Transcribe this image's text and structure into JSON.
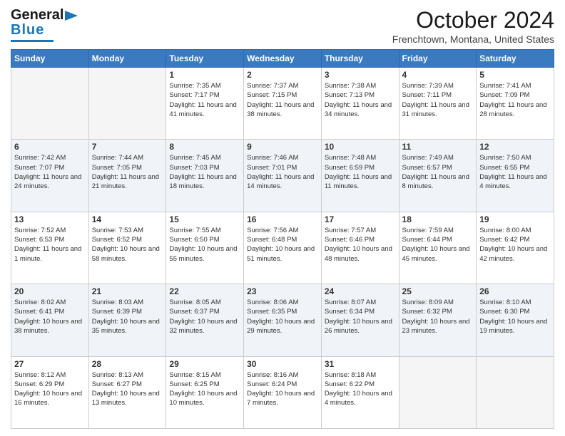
{
  "logo": {
    "general": "General",
    "blue": "Blue"
  },
  "title": "October 2024",
  "location": "Frenchtown, Montana, United States",
  "days_of_week": [
    "Sunday",
    "Monday",
    "Tuesday",
    "Wednesday",
    "Thursday",
    "Friday",
    "Saturday"
  ],
  "weeks": [
    [
      {
        "day": "",
        "info": ""
      },
      {
        "day": "",
        "info": ""
      },
      {
        "day": "1",
        "info": "Sunrise: 7:35 AM\nSunset: 7:17 PM\nDaylight: 11 hours and 41 minutes."
      },
      {
        "day": "2",
        "info": "Sunrise: 7:37 AM\nSunset: 7:15 PM\nDaylight: 11 hours and 38 minutes."
      },
      {
        "day": "3",
        "info": "Sunrise: 7:38 AM\nSunset: 7:13 PM\nDaylight: 11 hours and 34 minutes."
      },
      {
        "day": "4",
        "info": "Sunrise: 7:39 AM\nSunset: 7:11 PM\nDaylight: 11 hours and 31 minutes."
      },
      {
        "day": "5",
        "info": "Sunrise: 7:41 AM\nSunset: 7:09 PM\nDaylight: 11 hours and 28 minutes."
      }
    ],
    [
      {
        "day": "6",
        "info": "Sunrise: 7:42 AM\nSunset: 7:07 PM\nDaylight: 11 hours and 24 minutes."
      },
      {
        "day": "7",
        "info": "Sunrise: 7:44 AM\nSunset: 7:05 PM\nDaylight: 11 hours and 21 minutes."
      },
      {
        "day": "8",
        "info": "Sunrise: 7:45 AM\nSunset: 7:03 PM\nDaylight: 11 hours and 18 minutes."
      },
      {
        "day": "9",
        "info": "Sunrise: 7:46 AM\nSunset: 7:01 PM\nDaylight: 11 hours and 14 minutes."
      },
      {
        "day": "10",
        "info": "Sunrise: 7:48 AM\nSunset: 6:59 PM\nDaylight: 11 hours and 11 minutes."
      },
      {
        "day": "11",
        "info": "Sunrise: 7:49 AM\nSunset: 6:57 PM\nDaylight: 11 hours and 8 minutes."
      },
      {
        "day": "12",
        "info": "Sunrise: 7:50 AM\nSunset: 6:55 PM\nDaylight: 11 hours and 4 minutes."
      }
    ],
    [
      {
        "day": "13",
        "info": "Sunrise: 7:52 AM\nSunset: 6:53 PM\nDaylight: 11 hours and 1 minute."
      },
      {
        "day": "14",
        "info": "Sunrise: 7:53 AM\nSunset: 6:52 PM\nDaylight: 10 hours and 58 minutes."
      },
      {
        "day": "15",
        "info": "Sunrise: 7:55 AM\nSunset: 6:50 PM\nDaylight: 10 hours and 55 minutes."
      },
      {
        "day": "16",
        "info": "Sunrise: 7:56 AM\nSunset: 6:48 PM\nDaylight: 10 hours and 51 minutes."
      },
      {
        "day": "17",
        "info": "Sunrise: 7:57 AM\nSunset: 6:46 PM\nDaylight: 10 hours and 48 minutes."
      },
      {
        "day": "18",
        "info": "Sunrise: 7:59 AM\nSunset: 6:44 PM\nDaylight: 10 hours and 45 minutes."
      },
      {
        "day": "19",
        "info": "Sunrise: 8:00 AM\nSunset: 6:42 PM\nDaylight: 10 hours and 42 minutes."
      }
    ],
    [
      {
        "day": "20",
        "info": "Sunrise: 8:02 AM\nSunset: 6:41 PM\nDaylight: 10 hours and 38 minutes."
      },
      {
        "day": "21",
        "info": "Sunrise: 8:03 AM\nSunset: 6:39 PM\nDaylight: 10 hours and 35 minutes."
      },
      {
        "day": "22",
        "info": "Sunrise: 8:05 AM\nSunset: 6:37 PM\nDaylight: 10 hours and 32 minutes."
      },
      {
        "day": "23",
        "info": "Sunrise: 8:06 AM\nSunset: 6:35 PM\nDaylight: 10 hours and 29 minutes."
      },
      {
        "day": "24",
        "info": "Sunrise: 8:07 AM\nSunset: 6:34 PM\nDaylight: 10 hours and 26 minutes."
      },
      {
        "day": "25",
        "info": "Sunrise: 8:09 AM\nSunset: 6:32 PM\nDaylight: 10 hours and 23 minutes."
      },
      {
        "day": "26",
        "info": "Sunrise: 8:10 AM\nSunset: 6:30 PM\nDaylight: 10 hours and 19 minutes."
      }
    ],
    [
      {
        "day": "27",
        "info": "Sunrise: 8:12 AM\nSunset: 6:29 PM\nDaylight: 10 hours and 16 minutes."
      },
      {
        "day": "28",
        "info": "Sunrise: 8:13 AM\nSunset: 6:27 PM\nDaylight: 10 hours and 13 minutes."
      },
      {
        "day": "29",
        "info": "Sunrise: 8:15 AM\nSunset: 6:25 PM\nDaylight: 10 hours and 10 minutes."
      },
      {
        "day": "30",
        "info": "Sunrise: 8:16 AM\nSunset: 6:24 PM\nDaylight: 10 hours and 7 minutes."
      },
      {
        "day": "31",
        "info": "Sunrise: 8:18 AM\nSunset: 6:22 PM\nDaylight: 10 hours and 4 minutes."
      },
      {
        "day": "",
        "info": ""
      },
      {
        "day": "",
        "info": ""
      }
    ]
  ]
}
